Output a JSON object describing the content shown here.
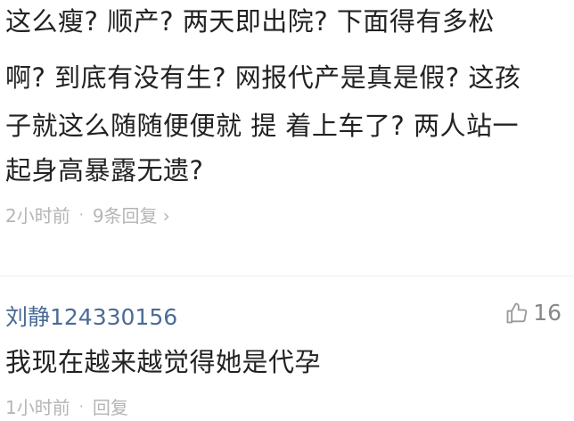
{
  "comments": [
    {
      "lines": [
        "这么瘦? 顺产? 两天即出院? 下面得有多松",
        "啊? 到底有没有生? 网报代产是真是假? 这孩",
        "子就这么随随便便就 提 着上车了? 两人站一",
        "起身高暴露无遗?"
      ],
      "time": "2小时前",
      "separator": "·",
      "reply": "9条回复",
      "reply_chevron": "›"
    },
    {
      "author": "刘静124330156",
      "likes": "16",
      "text": "我现在越来越觉得她是代孕",
      "time": "1小时前",
      "separator": "·",
      "reply": "回复"
    }
  ],
  "icons": {
    "like": "thumbs-up-icon",
    "reply_chevron": "chevron-right-icon"
  },
  "colors": {
    "text": "#222222",
    "meta": "#b5b5b5",
    "author": "#4a6b97",
    "like_count": "#888888"
  }
}
